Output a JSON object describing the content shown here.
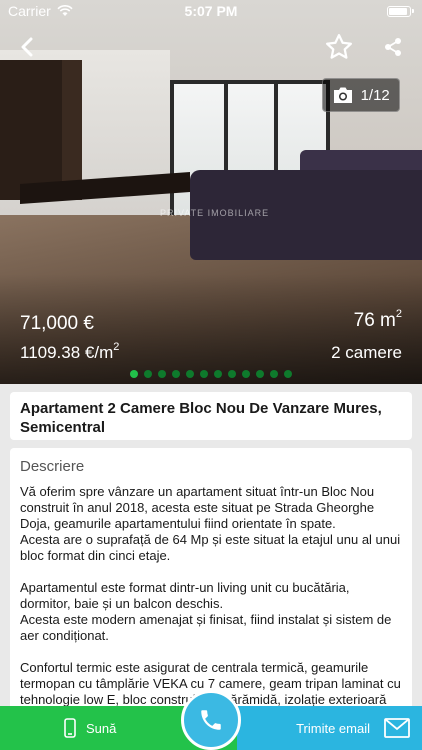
{
  "status": {
    "carrier": "Carrier",
    "time": "5:07 PM"
  },
  "gallery": {
    "counter": "1/12",
    "watermark": "PRIVATE IMOBILIARE",
    "dot_count": 12,
    "active_dot": 0
  },
  "listing": {
    "price": "71,000 €",
    "price_per_m2": "1109.38 €/m",
    "price_per_m2_sup": "2",
    "area": "76 m",
    "area_sup": "2",
    "rooms": "2 camere",
    "title": "Apartament 2 Camere Bloc Nou De Vanzare Mures, Semicentral"
  },
  "description": {
    "heading": "Descriere",
    "text": "Vă oferim spre vânzare un apartament situat într-un Bloc Nou construit în anul 2018, acesta este situat pe Strada Gheorghe Doja, geamurile apartamentului fiind orientate în spate.\nAcesta are o suprafață de 64 Mp și este situat la etajul unu al unui bloc format din cinci etaje.\n\nApartamentul este format dintr-un living unit cu bucătăria, dormitor, baie și un balcon deschis.\nAcesta este modern amenajat și finisat, fiind instalat și sistem de aer condiționat.\n\nConfortul termic este asigurat de centrala termică, geamurile termopan cu tâmplărie VEKA cu 7 camere, geam tripan laminat cu tehnologie low E, bloc construit din cărămidă, izolație exterioară cu"
  },
  "actions": {
    "call_label": "Sună",
    "email_label": "Trimite email"
  },
  "colors": {
    "green": "#23c24a",
    "blue": "#2bb5e0",
    "dot": "#0e7a2c"
  }
}
